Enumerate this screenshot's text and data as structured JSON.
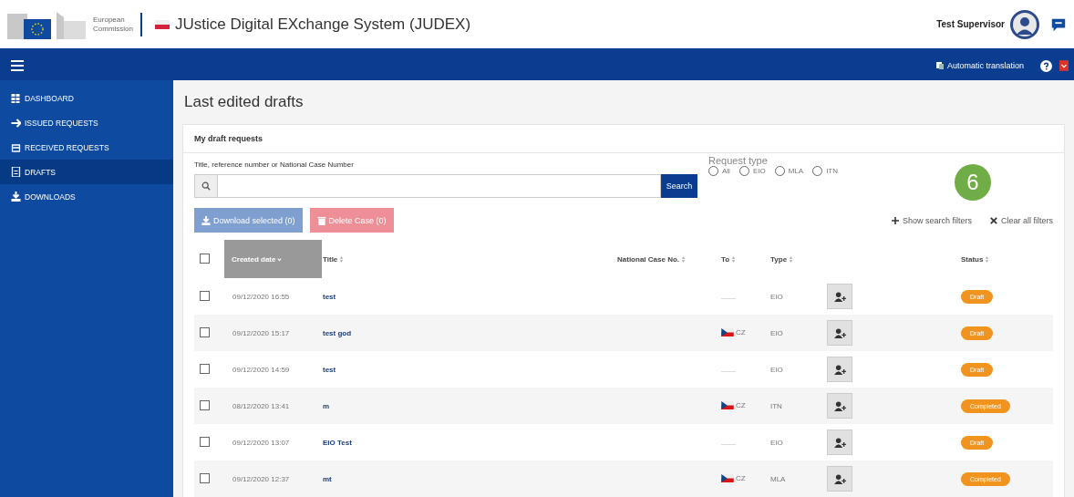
{
  "header": {
    "org_line1": "European",
    "org_line2": "Commission",
    "app_title": "JUstice Digital EXchange System (JUDEX)",
    "user_name": "Test Supervisor"
  },
  "topbar": {
    "translation_link": "Automatic translation"
  },
  "sidebar": {
    "items": [
      {
        "label": "DASHBOARD",
        "kind": "grid",
        "selected": false
      },
      {
        "label": "ISSUED REQUESTS",
        "kind": "plane",
        "selected": false
      },
      {
        "label": "RECEIVED REQUESTS",
        "kind": "tray",
        "selected": false
      },
      {
        "label": "DRAFTS",
        "kind": "doc",
        "selected": true
      },
      {
        "label": "DOWNLOADS",
        "kind": "download",
        "selected": false
      }
    ]
  },
  "page": {
    "title": "Last edited drafts",
    "section_title": "My draft requests",
    "search": {
      "label": "Title, reference number or National Case Number",
      "button": "Search"
    },
    "request_type": {
      "label": "Request type",
      "options": [
        {
          "label": "All",
          "selected": false
        },
        {
          "label": "EIO",
          "selected": false
        },
        {
          "label": "MLA",
          "selected": false
        },
        {
          "label": "ITN",
          "selected": false
        }
      ]
    },
    "annotation_badge": "6",
    "actions": {
      "download": "Download selected (0)",
      "delete": "Delete Case (0)",
      "show_filters": "Show search filters",
      "clear_filters": "Clear all filters"
    }
  },
  "table": {
    "all_checked": false,
    "columns": [
      {
        "label": "Created date",
        "sorted": true
      },
      {
        "label": "Title",
        "sorted": false
      },
      {
        "label": "National Case No.",
        "sorted": false
      },
      {
        "label": "To",
        "sorted": false
      },
      {
        "label": "Type",
        "sorted": false
      },
      {
        "label": "Status",
        "sorted": false
      }
    ],
    "rows": [
      {
        "checked": false,
        "created": "09/12/2020 16:55",
        "title": "test",
        "to": null,
        "type": "EIO",
        "status": "Draft"
      },
      {
        "checked": false,
        "created": "09/12/2020 15:17",
        "title": "test god",
        "to": "CZ",
        "type": "EIO",
        "status": "Draft"
      },
      {
        "checked": false,
        "created": "09/12/2020 14:59",
        "title": "test",
        "to": null,
        "type": "EIO",
        "status": "Draft"
      },
      {
        "checked": false,
        "created": "08/12/2020 13:41",
        "title": "m",
        "to": "CZ",
        "type": "ITN",
        "status": "Completed"
      },
      {
        "checked": false,
        "created": "09/12/2020 13:07",
        "title": "EIO Test",
        "to": null,
        "type": "EIO",
        "status": "Draft"
      },
      {
        "checked": false,
        "created": "09/12/2020 12:37",
        "title": "mt",
        "to": "CZ",
        "type": "MLA",
        "status": "Completed"
      }
    ]
  }
}
